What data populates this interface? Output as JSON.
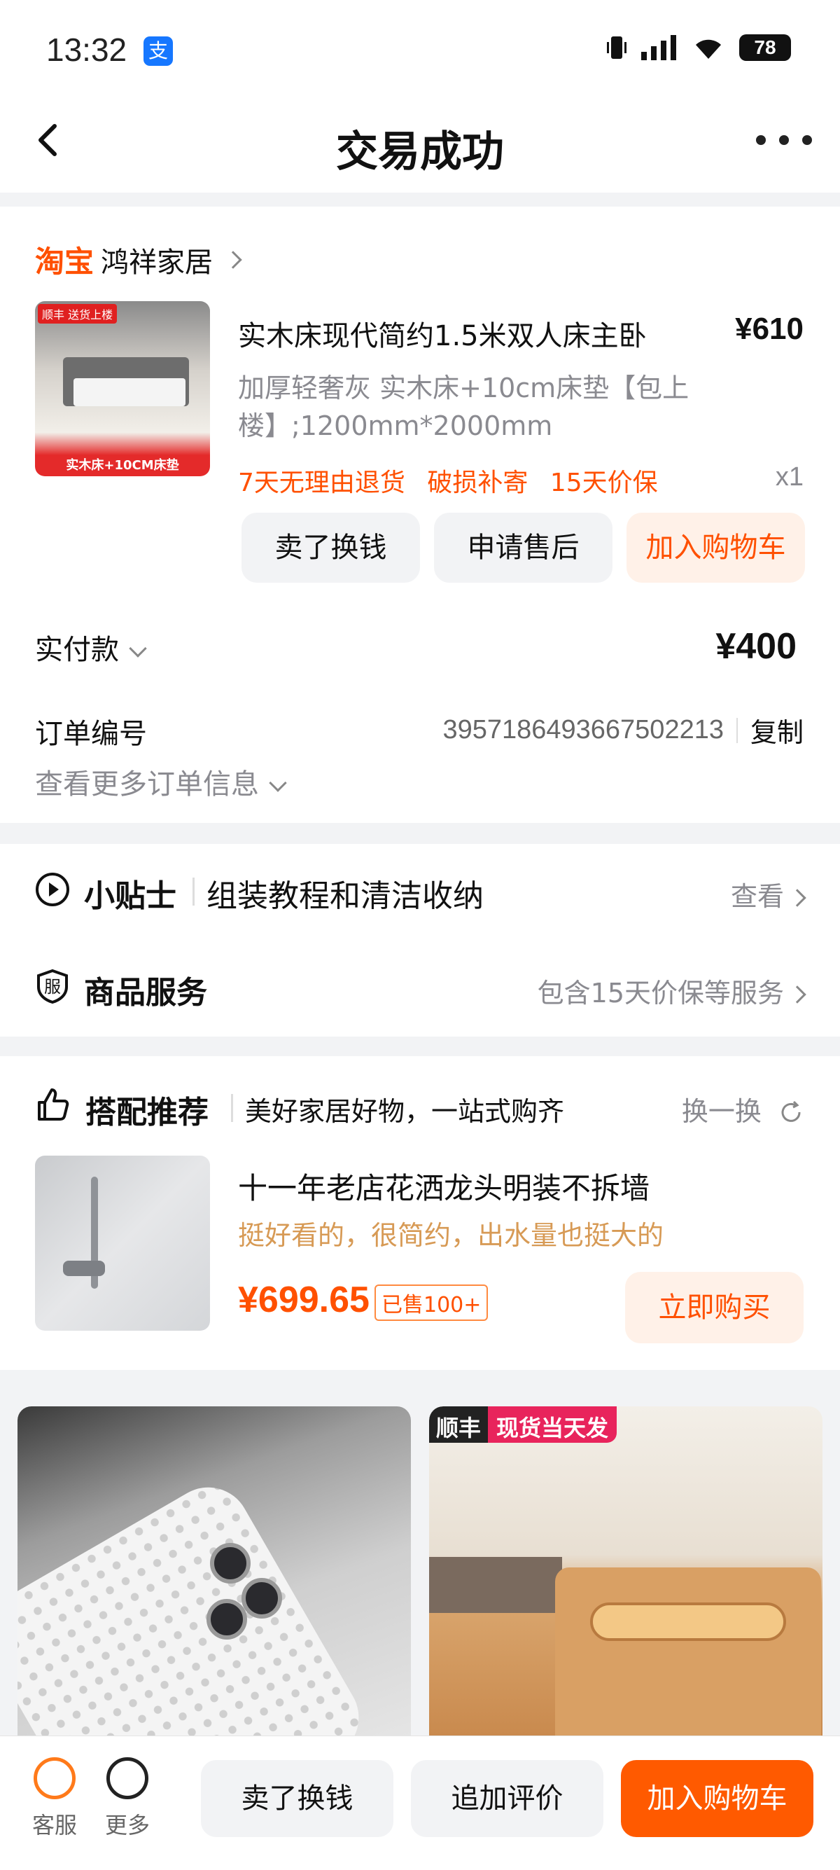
{
  "status": {
    "time": "13:32",
    "battery": "78"
  },
  "nav": {
    "title": "交易成功"
  },
  "order": {
    "shop_logo": "淘宝",
    "shop_name": "鸿祥家居",
    "thumb_badge": "顺丰 送货上楼",
    "thumb_caption": "实木床+10CM床垫",
    "product_title": "实木床现代简约1.5米双人床主卧",
    "price": "¥610",
    "spec": "加厚轻奢灰 实木床+10cm床垫【包上楼】;1200mm*2000mm",
    "tags": [
      "7天无理由退货",
      "破损补寄",
      "15天价保"
    ],
    "quantity": "x1",
    "actions": [
      "卖了换钱",
      "申请售后",
      "加入购物车"
    ],
    "paid_label": "实付款",
    "paid_amount": "¥400",
    "order_no_label": "订单编号",
    "order_no": "3957186493667502213",
    "copy_label": "复制",
    "more_info": "查看更多订单信息"
  },
  "services": {
    "tips_title": "小贴士",
    "tips_sub": "组装教程和清洁收纳",
    "tips_action": "查看",
    "goods_title": "商品服务",
    "goods_value": "包含15天价保等服务",
    "goods_icon_char": "服"
  },
  "recommend": {
    "title": "搭配推荐",
    "subtitle": "美好家居好物，一站式购齐",
    "refresh": "换一换",
    "product_title": "十一年老店花洒龙头明装不拆墙",
    "product_desc": "挺好看的，很简约，出水量也挺大的",
    "price": "¥699.65",
    "sold": "已售100+",
    "buy": "立即购买"
  },
  "feed": {
    "right_badge_a": "顺丰",
    "right_badge_b": "现货当天发"
  },
  "bottom": {
    "service_label": "客服",
    "more_label": "更多",
    "sell": "卖了换钱",
    "review": "追加评价",
    "add_cart": "加入购物车"
  },
  "colors": {
    "accent": "#ff5000",
    "primary_button": "#ff5a00"
  }
}
